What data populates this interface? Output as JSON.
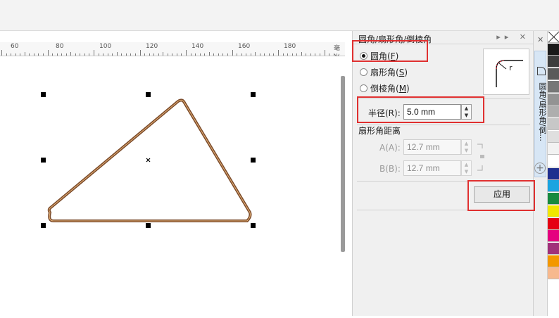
{
  "ruler": {
    "labels": [
      "60",
      "80",
      "100",
      "120",
      "140",
      "160",
      "180"
    ],
    "unit": "毫米"
  },
  "panel": {
    "title": "圆角/扇形角/倒棱角",
    "controls": "▸▸ ✕",
    "options": [
      {
        "label": "圆角(",
        "key": "F",
        "suffix": ")",
        "checked": true
      },
      {
        "label": "扇形角(",
        "key": "S",
        "suffix": ")",
        "checked": false
      },
      {
        "label": "倒棱角(",
        "key": "M",
        "suffix": ")",
        "checked": false
      }
    ],
    "radius": {
      "label": "半径(R):",
      "value": "5.0 mm"
    },
    "distance_heading": "扇形角距离",
    "a": {
      "label": "A(A):",
      "value": "12.7 mm"
    },
    "b": {
      "label": "B(B):",
      "value": "12.7 mm"
    },
    "apply": "应用"
  },
  "tabs": {
    "active_label": "圆角/扇形角/倒...",
    "close_glyph": "✕",
    "add_glyph": "+"
  },
  "palette": {
    "colors": [
      "#ffffff",
      "#1a1a1a",
      "#3d3d3d",
      "#5a5a5a",
      "#777777",
      "#939393",
      "#aeaeae",
      "#c7c7c7",
      "#dfdfdf",
      "#f2f2f2",
      "#ffffff",
      "#1f2f8f",
      "#1ba4e0",
      "#178a3e",
      "#f0e600",
      "#e50012",
      "#e5007f",
      "#a0307a",
      "#f39800",
      "#f7b98e"
    ]
  },
  "shape_color": "#7a4a2a"
}
